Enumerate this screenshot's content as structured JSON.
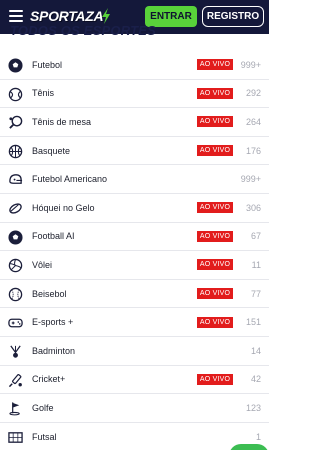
{
  "header": {
    "logo_text": "SPORTAZA",
    "login_label": "ENTRAR",
    "register_label": "REGISTRO"
  },
  "section_title": "TODOS OS ESPORTES",
  "live_label": "AO VIVO",
  "colors": {
    "header_bg": "#14183a",
    "accent_green": "#59d23a",
    "live_red": "#e21c1c"
  },
  "sports": [
    {
      "name": "Futebol",
      "live": true,
      "count": "999+",
      "icon": "soccer-ball-icon"
    },
    {
      "name": "Tênis",
      "live": true,
      "count": "292",
      "icon": "tennis-ball-icon"
    },
    {
      "name": "Tênis de mesa",
      "live": true,
      "count": "264",
      "icon": "table-tennis-icon"
    },
    {
      "name": "Basquete",
      "live": true,
      "count": "176",
      "icon": "basketball-icon"
    },
    {
      "name": "Futebol Americano",
      "live": false,
      "count": "999+",
      "icon": "american-football-helmet-icon"
    },
    {
      "name": "Hóquei no Gelo",
      "live": true,
      "count": "306",
      "icon": "hockey-puck-icon"
    },
    {
      "name": "Football AI",
      "live": true,
      "count": "67",
      "icon": "soccer-ball-icon"
    },
    {
      "name": "Vôlei",
      "live": true,
      "count": "11",
      "icon": "volleyball-icon"
    },
    {
      "name": "Beisebol",
      "live": true,
      "count": "77",
      "icon": "baseball-icon"
    },
    {
      "name": "E-sports +",
      "live": true,
      "count": "151",
      "icon": "gamepad-icon"
    },
    {
      "name": "Badminton",
      "live": false,
      "count": "14",
      "icon": "shuttlecock-icon"
    },
    {
      "name": "Cricket+",
      "live": true,
      "count": "42",
      "icon": "cricket-bat-icon"
    },
    {
      "name": "Golfe",
      "live": false,
      "count": "123",
      "icon": "golf-flag-icon"
    },
    {
      "name": "Futsal",
      "live": false,
      "count": "1",
      "icon": "futsal-goal-icon"
    }
  ]
}
